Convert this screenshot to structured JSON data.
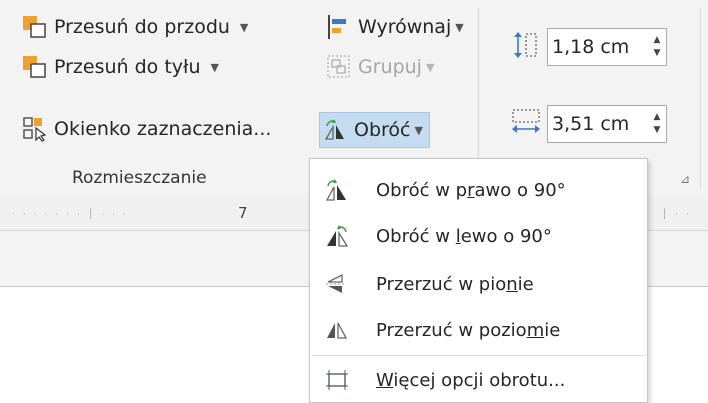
{
  "ribbon": {
    "group_label": "Rozmieszczanie",
    "bring_forward": "Przesuń do przodu",
    "send_backward": "Przesuń do tyłu",
    "selection_pane": "Okienko zaznaczenia...",
    "align": "Wyrównaj",
    "group": "Grupuj",
    "rotate": "Obróć",
    "height_value": "1,18 cm",
    "width_value": "3,51 cm"
  },
  "ruler": {
    "number": "7"
  },
  "rotate_menu": {
    "items": [
      {
        "pre": "Obróć w p",
        "key": "r",
        "post": "awo o 90°"
      },
      {
        "pre": "Obróć w ",
        "key": "l",
        "post": "ewo o 90°"
      },
      {
        "pre": "Przerzuć w pio",
        "key": "n",
        "post": "ie"
      },
      {
        "pre": "Przerzuć w pozio",
        "key": "m",
        "post": "ie"
      },
      {
        "pre": "",
        "key": "W",
        "post": "ięcej opcji obrotu..."
      }
    ]
  },
  "colors": {
    "accent_orange": "#f0a030",
    "accent_blue": "#3f77c0",
    "pressed_bg": "#c5dcf0"
  }
}
